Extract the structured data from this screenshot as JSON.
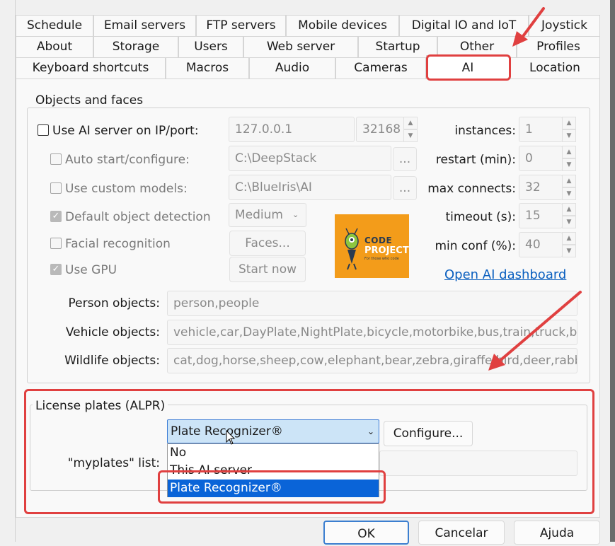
{
  "tabs": {
    "row1": [
      "Schedule",
      "Email servers",
      "FTP servers",
      "Mobile devices",
      "Digital IO and IoT",
      "Joystick"
    ],
    "row2": [
      "About",
      "Storage",
      "Users",
      "Web server",
      "Startup",
      "Other",
      "Profiles"
    ],
    "row3": [
      "Keyboard shortcuts",
      "Macros",
      "Audio",
      "Cameras",
      "AI",
      "Location"
    ]
  },
  "objects_group": {
    "title": "Objects and faces",
    "use_ai_server": "Use AI server on IP/port:",
    "ip": "127.0.0.1",
    "port": "32168",
    "auto_start": "Auto start/configure:",
    "auto_start_path": "C:\\DeepStack",
    "custom_models": "Use custom models:",
    "custom_models_path": "C:\\BlueIris\\AI",
    "browse": "...",
    "default_detection": "Default object detection",
    "detection_level": "Medium",
    "facial": "Facial recognition",
    "faces_button": "Faces...",
    "use_gpu": "Use GPU",
    "start_now": "Start now",
    "instances_label": "instances:",
    "instances": "1",
    "restart_label": "restart (min):",
    "restart": "0",
    "max_connects_label": "max connects:",
    "max_connects": "32",
    "timeout_label": "timeout (s):",
    "timeout": "15",
    "min_conf_label": "min conf (%):",
    "min_conf": "40",
    "dashboard_link": "Open AI dashboard",
    "logo_line1": "CODE",
    "logo_line2": "PROJECT",
    "logo_line3": "For those who code",
    "person_label": "Person objects:",
    "person": "person,people",
    "vehicle_label": "Vehicle objects:",
    "vehicle": "vehicle,car,DayPlate,NightPlate,bicycle,motorbike,bus,train,truck,boat",
    "wildlife_label": "Wildlife objects:",
    "wildlife": "cat,dog,horse,sheep,cow,elephant,bear,zebra,giraffe,bird,deer,rabbit,racc"
  },
  "alpr_group": {
    "title": "License plates (ALPR)",
    "selected": "Plate Recognizer®",
    "configure": "Configure...",
    "myplates_label": "\"myplates\" list:",
    "options": [
      "No",
      "This AI server",
      "Plate Recognizer®"
    ]
  },
  "footer": {
    "ok": "OK",
    "cancel": "Cancelar",
    "help": "Ajuda"
  },
  "colors": {
    "annotation_red": "#e04040",
    "link_blue": "#0a5fbf",
    "selection_blue": "#0a64d8",
    "logo_orange": "#f39c1a"
  }
}
